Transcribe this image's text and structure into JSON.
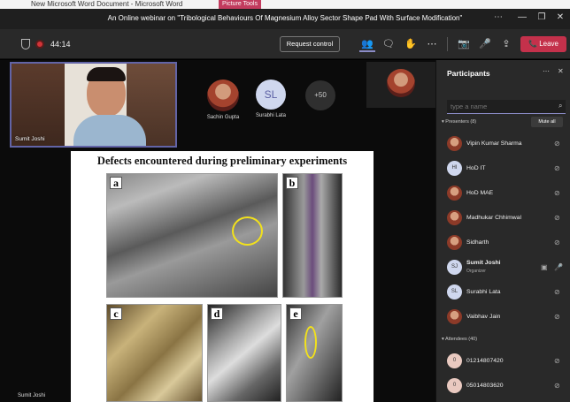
{
  "word": {
    "title": "New Microsoft Word Document  -  Microsoft Word",
    "picture_tools": "Picture Tools"
  },
  "window": {
    "title": "An Online webinar on \"Tribological Behaviours Of Magnesium Alloy Sector Shape Pad With Surface Modification\"",
    "controls": {
      "more": "⋯",
      "minimize": "—",
      "restore": "❐",
      "close": "✕"
    }
  },
  "toolbar": {
    "timer": "44:14",
    "request_control": "Request control",
    "leave": "Leave",
    "icons": {
      "people": "👥",
      "chat": "🗨",
      "hand": "✋",
      "more": "⋯",
      "camera": "📷",
      "mic": "🎤",
      "share": "⇪",
      "phone": "📞"
    },
    "colors": {
      "leave": "#c4314b",
      "record": "#d13438",
      "accent": "#6264a7"
    }
  },
  "stage": {
    "speaker_name": "Sumit Joshi",
    "participants": [
      {
        "name": "Sachin Gupta"
      },
      {
        "initials": "SL",
        "name": "Surabhi Lata"
      }
    ],
    "overflow": "+50",
    "self_name": "Sumit Joshi"
  },
  "slide": {
    "title": "Defects encountered during preliminary experiments",
    "panels": [
      "a",
      "b",
      "c",
      "d",
      "e"
    ]
  },
  "panel": {
    "title": "Participants",
    "more_icon": "⋯",
    "close_icon": "✕",
    "search_placeholder": "type a name",
    "presenters_label": "Presenters (8)",
    "mute_all": "Mute all",
    "presenters": [
      {
        "name": "Vipin Kumar Sharma",
        "initials": ""
      },
      {
        "name": "HoD IT",
        "initials": "HI"
      },
      {
        "name": "HoD MAE",
        "initials": ""
      },
      {
        "name": "Madhukar Chhimwal",
        "initials": ""
      },
      {
        "name": "Sidharth",
        "initials": ""
      },
      {
        "name": "Sumit Joshi",
        "initials": "SJ",
        "role": "Organizer"
      },
      {
        "name": "Surabhi Lata",
        "initials": "SL"
      },
      {
        "name": "Vaibhav Jain",
        "initials": ""
      }
    ],
    "attendees_label": "Attendees (40)",
    "attendees": [
      {
        "name": "01214807420",
        "initials": "0"
      },
      {
        "name": "05014803620",
        "initials": "0"
      }
    ]
  }
}
